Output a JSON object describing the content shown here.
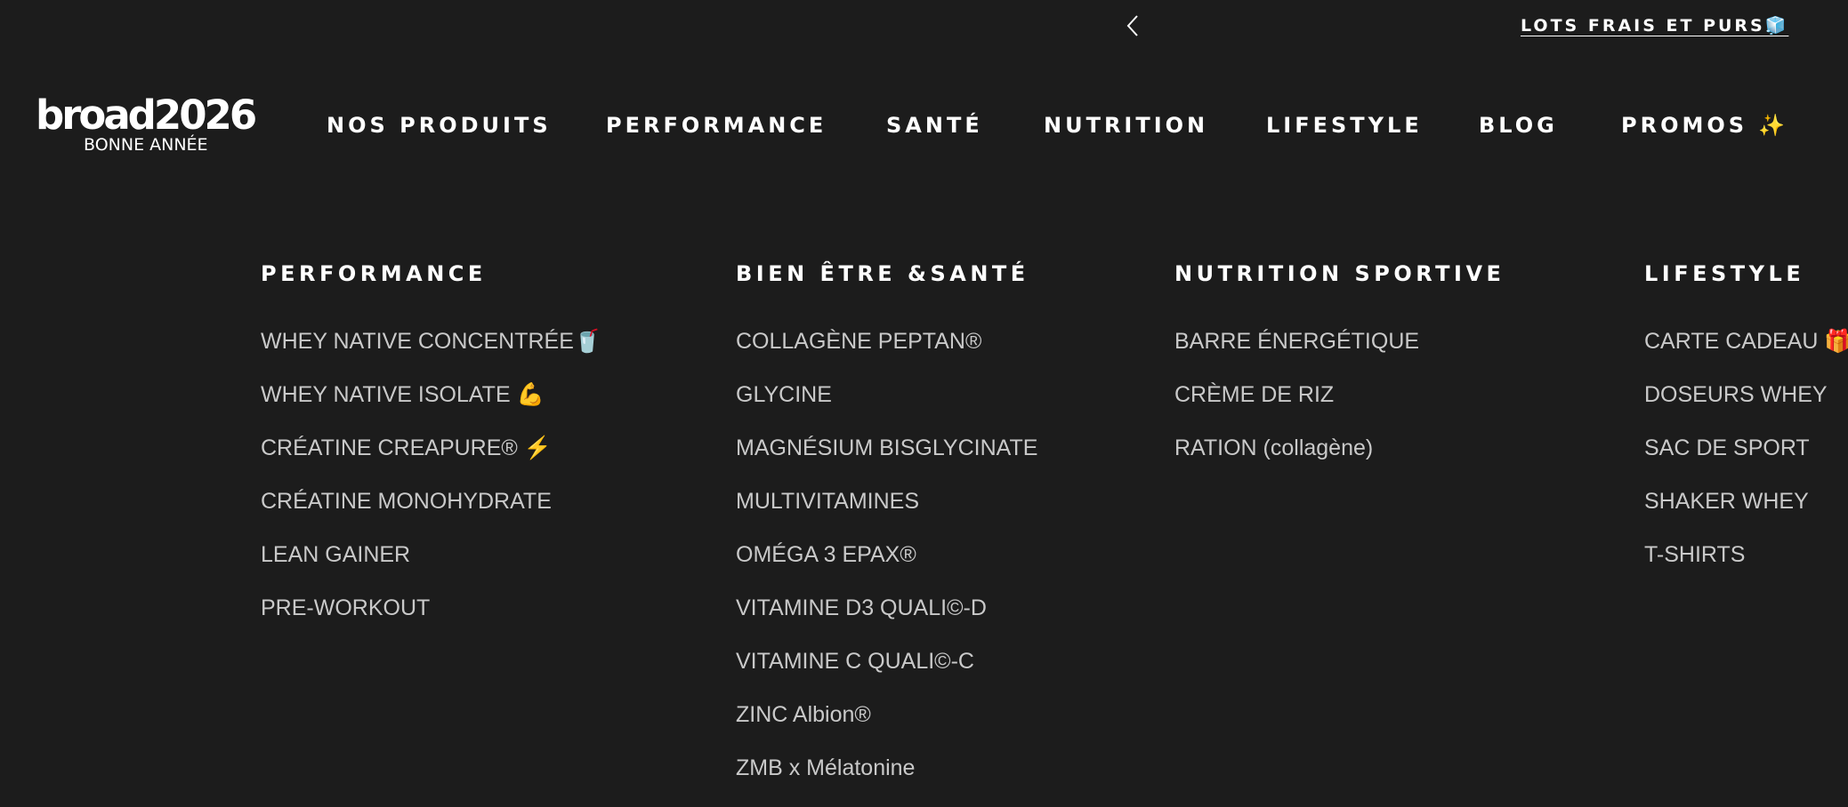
{
  "announcement": {
    "prev_icon": "chevron-left-icon",
    "text": "LOTS FRAIS ET PURS🧊"
  },
  "logo": {
    "main": "broad2026",
    "sub": "BONNE ANNÉE"
  },
  "nav": {
    "items": [
      {
        "label": "NOS PRODUITS"
      },
      {
        "label": "PERFORMANCE"
      },
      {
        "label": "SANTÉ"
      },
      {
        "label": "NUTRITION"
      },
      {
        "label": "LIFESTYLE"
      },
      {
        "label": "BLOG"
      },
      {
        "label": "PROMOS ✨"
      }
    ]
  },
  "menu": {
    "columns": [
      {
        "title": "PERFORMANCE",
        "items": [
          "WHEY NATIVE CONCENTRÉE🥤",
          "WHEY NATIVE ISOLATE 💪",
          "CRÉATINE CREAPURE® ⚡",
          "CRÉATINE MONOHYDRATE",
          "LEAN GAINER",
          "PRE-WORKOUT"
        ]
      },
      {
        "title": "BIEN ÊTRE &SANTÉ",
        "items": [
          "COLLAGÈNE PEPTAN®",
          "GLYCINE",
          "MAGNÉSIUM BISGLYCINATE",
          "MULTIVITAMINES",
          "OMÉGA 3 EPAX®",
          "VITAMINE D3 QUALI©-D",
          "VITAMINE C QUALI©-C",
          "ZINC Albion®",
          "ZMB x Mélatonine"
        ]
      },
      {
        "title": "NUTRITION SPORTIVE",
        "items": [
          "BARRE ÉNERGÉTIQUE",
          "CRÈME DE RIZ",
          "RATION (collagène)"
        ]
      },
      {
        "title": "LIFESTYLE",
        "items": [
          "CARTE CADEAU 🎁",
          "DOSEURS WHEY",
          "SAC DE SPORT",
          "SHAKER WHEY",
          "T-SHIRTS"
        ]
      }
    ]
  },
  "colors": {
    "background": "#1c1c1c",
    "heading": "#ffffff",
    "link": "#c9c9c9"
  }
}
